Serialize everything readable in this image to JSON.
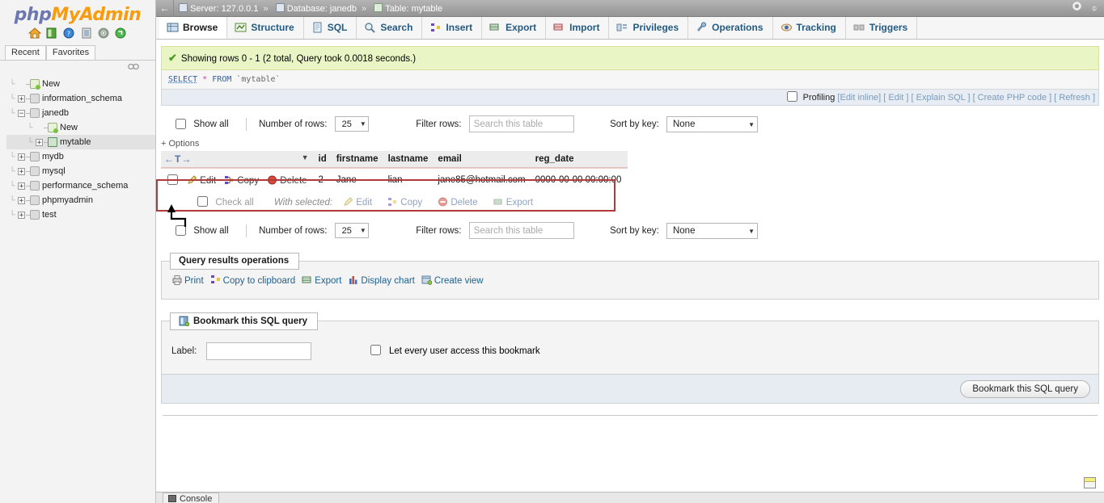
{
  "app": {
    "logo_php": "php",
    "logo_my": "My",
    "logo_admin": "Admin",
    "logo_icons": [
      "home-icon",
      "server-icon",
      "help-icon",
      "docs-icon",
      "settings-icon",
      "refresh-icon"
    ]
  },
  "sidebar": {
    "tabs": [
      {
        "label": "Recent"
      },
      {
        "label": "Favorites"
      }
    ],
    "collapse_icon": "collapse-sidebar-icon",
    "tree": [
      {
        "label": "New",
        "expander": "",
        "icon": "new-database-icon",
        "indent": 0,
        "selected": false
      },
      {
        "label": "information_schema",
        "expander": "+",
        "icon": "database-icon",
        "indent": 0,
        "selected": false
      },
      {
        "label": "janedb",
        "expander": "−",
        "icon": "database-icon",
        "indent": 0,
        "selected": false
      },
      {
        "label": "New",
        "expander": "",
        "icon": "new-table-icon",
        "indent": 1,
        "selected": false
      },
      {
        "label": "mytable",
        "expander": "+",
        "icon": "table-icon",
        "indent": 1,
        "selected": true
      },
      {
        "label": "mydb",
        "expander": "+",
        "icon": "database-icon",
        "indent": 0,
        "selected": false
      },
      {
        "label": "mysql",
        "expander": "+",
        "icon": "database-icon",
        "indent": 0,
        "selected": false
      },
      {
        "label": "performance_schema",
        "expander": "+",
        "icon": "database-icon",
        "indent": 0,
        "selected": false
      },
      {
        "label": "phpmyadmin",
        "expander": "+",
        "icon": "database-icon",
        "indent": 0,
        "selected": false
      },
      {
        "label": "test",
        "expander": "+",
        "icon": "database-icon",
        "indent": 0,
        "selected": false
      }
    ]
  },
  "breadcrumb": {
    "back_icon": "back-arrow-icon",
    "server_label": "Server: 127.0.0.1",
    "database_label": "Database: janedb",
    "table_label": "Table: mytable",
    "separator": "»",
    "right_icons": [
      "gear-icon",
      "collapse-icon"
    ]
  },
  "tabs": [
    {
      "label": "Browse",
      "icon": "browse-icon",
      "active": true
    },
    {
      "label": "Structure",
      "icon": "structure-icon",
      "active": false
    },
    {
      "label": "SQL",
      "icon": "sql-icon",
      "active": false
    },
    {
      "label": "Search",
      "icon": "search-icon",
      "active": false
    },
    {
      "label": "Insert",
      "icon": "insert-icon",
      "active": false
    },
    {
      "label": "Export",
      "icon": "export-icon",
      "active": false
    },
    {
      "label": "Import",
      "icon": "import-icon",
      "active": false
    },
    {
      "label": "Privileges",
      "icon": "privileges-icon",
      "active": false
    },
    {
      "label": "Operations",
      "icon": "operations-icon",
      "active": false
    },
    {
      "label": "Tracking",
      "icon": "tracking-icon",
      "active": false
    },
    {
      "label": "Triggers",
      "icon": "triggers-icon",
      "active": false
    }
  ],
  "result_message": {
    "icon": "success-check-icon",
    "text": "Showing rows 0 - 1 (2 total, Query took 0.0018 seconds.)"
  },
  "sql_query": {
    "keyword": "SELECT",
    "star": "*",
    "from": "FROM",
    "table": "`mytable`"
  },
  "profiling": {
    "label": "Profiling",
    "links": [
      "[Edit inline]",
      "[ Edit ]",
      "[ Explain SQL ]",
      "[ Create PHP code ]",
      "[ Refresh ]"
    ]
  },
  "filters": {
    "show_all_label": "Show all",
    "number_of_rows_label": "Number of rows:",
    "number_of_rows_value": "25",
    "filter_rows_label": "Filter rows:",
    "filter_rows_placeholder": "Search this table",
    "sort_by_key_label": "Sort by key:",
    "sort_by_key_value": "None",
    "options_label": "+ Options"
  },
  "table": {
    "nav_arrows": "←T→",
    "sort_caret": "▼",
    "columns": [
      "id",
      "firstname",
      "lastname",
      "email",
      "reg_date"
    ],
    "row_actions": [
      {
        "label": "Edit",
        "icon": "pencil-icon"
      },
      {
        "label": "Copy",
        "icon": "copy-icon"
      },
      {
        "label": "Delete",
        "icon": "delete-icon"
      }
    ],
    "rows": [
      {
        "id": "2",
        "firstname": "Jane",
        "lastname": "lian",
        "email": "jane85@hotmail.com",
        "reg_date": "0000-00-00 00:00:00"
      }
    ]
  },
  "check_all": {
    "label": "Check all",
    "with_selected_label": "With selected:",
    "actions": [
      {
        "label": "Edit",
        "icon": "pencil-icon"
      },
      {
        "label": "Copy",
        "icon": "copy-icon"
      },
      {
        "label": "Delete",
        "icon": "delete-icon"
      },
      {
        "label": "Export",
        "icon": "export-icon"
      }
    ]
  },
  "query_results_operations": {
    "legend": "Query results operations",
    "legend_icon": "",
    "items": [
      {
        "label": "Print",
        "icon": "print-icon"
      },
      {
        "label": "Copy to clipboard",
        "icon": "clipboard-icon"
      },
      {
        "label": "Export",
        "icon": "export-icon"
      },
      {
        "label": "Display chart",
        "icon": "chart-icon"
      },
      {
        "label": "Create view",
        "icon": "create-view-icon"
      }
    ]
  },
  "bookmark": {
    "legend": "Bookmark this SQL query",
    "legend_icon": "bookmark-icon",
    "label_text": "Label:",
    "label_value": "",
    "checkbox_label": "Let every user access this bookmark",
    "submit_label": "Bookmark this SQL query"
  },
  "bottom": {
    "form_icon": "form-window-icon",
    "console_label": "Console",
    "console_icon": "console-icon"
  },
  "annotation": {
    "highlight_color": "#b03a3a",
    "arrow_color": "#000000"
  }
}
